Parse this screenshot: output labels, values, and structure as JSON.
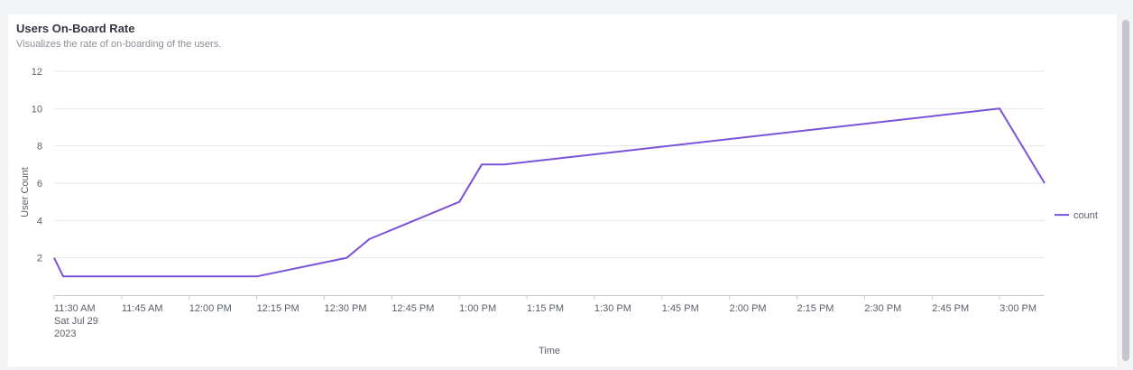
{
  "card": {
    "title": "Users On-Board Rate",
    "subtitle": "Visualizes the rate of on-boarding of the users."
  },
  "colors": {
    "series": "#7b52d9",
    "grid": "#e6e7ea",
    "axis": "#c9ccd1"
  },
  "chart_data": {
    "type": "line",
    "title": "Users On-Board Rate",
    "subtitle": "Visualizes the rate of on-boarding of the users.",
    "xlabel": "Time",
    "ylabel": "User Count",
    "x_range": [
      "11:30 AM",
      "3:03 PM"
    ],
    "ylim": [
      0,
      12
    ],
    "y_ticks": [
      2,
      4,
      6,
      8,
      10,
      12
    ],
    "x_ticks": [
      {
        "t": "11:30",
        "label": "11:30 AM",
        "sub": [
          "Sat Jul 29",
          "2023"
        ]
      },
      {
        "t": "11:45",
        "label": "11:45 AM"
      },
      {
        "t": "12:00",
        "label": "12:00 PM"
      },
      {
        "t": "12:15",
        "label": "12:15 PM"
      },
      {
        "t": "12:30",
        "label": "12:30 PM"
      },
      {
        "t": "12:45",
        "label": "12:45 PM"
      },
      {
        "t": "13:00",
        "label": "1:00 PM"
      },
      {
        "t": "13:15",
        "label": "1:15 PM"
      },
      {
        "t": "13:30",
        "label": "1:30 PM"
      },
      {
        "t": "13:45",
        "label": "1:45 PM"
      },
      {
        "t": "14:00",
        "label": "2:00 PM"
      },
      {
        "t": "14:15",
        "label": "2:15 PM"
      },
      {
        "t": "14:30",
        "label": "2:30 PM"
      },
      {
        "t": "14:45",
        "label": "2:45 PM"
      },
      {
        "t": "15:00",
        "label": "3:00 PM"
      }
    ],
    "grid": true,
    "legend": "right",
    "series": [
      {
        "name": "count",
        "points": [
          {
            "x": "11:30",
            "y": 2
          },
          {
            "x": "11:32",
            "y": 1
          },
          {
            "x": "12:15",
            "y": 1
          },
          {
            "x": "12:35",
            "y": 2
          },
          {
            "x": "12:40",
            "y": 3
          },
          {
            "x": "13:00",
            "y": 5
          },
          {
            "x": "13:05",
            "y": 7
          },
          {
            "x": "13:10",
            "y": 7
          },
          {
            "x": "15:00",
            "y": 10
          },
          {
            "x": "15:10",
            "y": 6
          }
        ]
      }
    ]
  }
}
